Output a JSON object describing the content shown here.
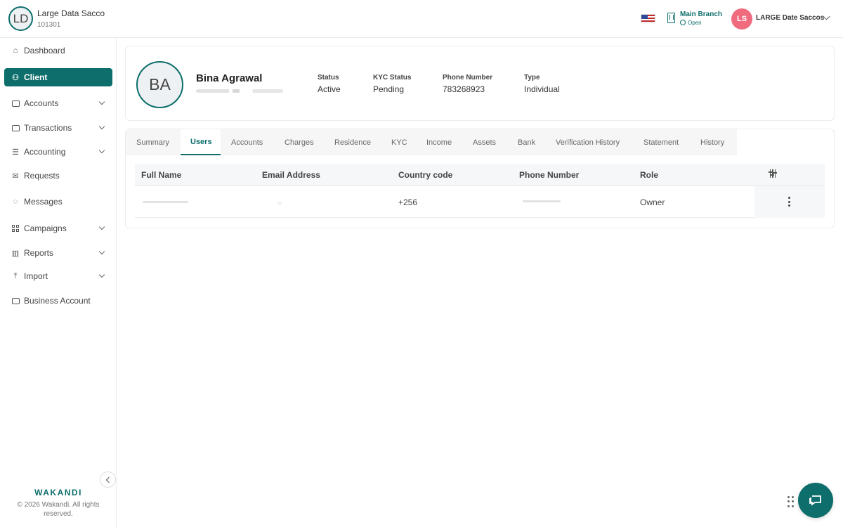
{
  "header": {
    "org_initials": "LD",
    "org_name": "Large Data Sacco",
    "org_code": "101301",
    "branch_name": "Main Branch",
    "branch_status": "Open",
    "user_initials": "LS",
    "user_name": "LARGE Date Saccos",
    "flag_icon": "us-flag-icon"
  },
  "sidebar": {
    "items": [
      {
        "label": "Dashboard",
        "icon": "home-icon"
      },
      {
        "label": "Client",
        "icon": "client-icon",
        "active": true
      },
      {
        "label": "Accounts",
        "icon": "briefcase-icon",
        "expandable": true
      },
      {
        "label": "Transactions",
        "icon": "money-icon",
        "expandable": true
      },
      {
        "label": "Accounting",
        "icon": "ledger-icon",
        "expandable": true
      },
      {
        "label": "Requests",
        "icon": "mail-icon"
      },
      {
        "label": "Messages",
        "icon": "chat-icon"
      },
      {
        "label": "Campaigns",
        "icon": "grid-icon",
        "expandable": true
      },
      {
        "label": "Reports",
        "icon": "bar-chart-icon",
        "expandable": true
      },
      {
        "label": "Import",
        "icon": "upload-icon",
        "expandable": true
      },
      {
        "label": "Business Account",
        "icon": "briefcase-icon"
      }
    ],
    "brand": "WAKANDI",
    "copyright": "© 2026 Wakandi. All rights reserved."
  },
  "profile": {
    "initials": "BA",
    "name": "Bina Agrawal",
    "status_label": "Status",
    "status_value": "Active",
    "kyc_label": "KYC Status",
    "kyc_value": "Pending",
    "phone_label": "Phone Number",
    "phone_value": "783268923",
    "type_label": "Type",
    "type_value": "Individual"
  },
  "tabs": [
    "Summary",
    "Users",
    "Accounts",
    "Charges",
    "Residence",
    "KYC",
    "Income",
    "Assets",
    "Bank",
    "Verification History",
    "Statement",
    "History"
  ],
  "active_tab": "Users",
  "users_table": {
    "columns": [
      "Full Name",
      "Email Address",
      "Country code",
      "Phone Number",
      "Role"
    ],
    "rows": [
      {
        "full_name": "",
        "email": "",
        "country_code": "+256",
        "phone": "",
        "role": "Owner"
      }
    ]
  },
  "colors": {
    "accent": "#0d6e6b",
    "avatar_user": "#ef6b7d"
  }
}
